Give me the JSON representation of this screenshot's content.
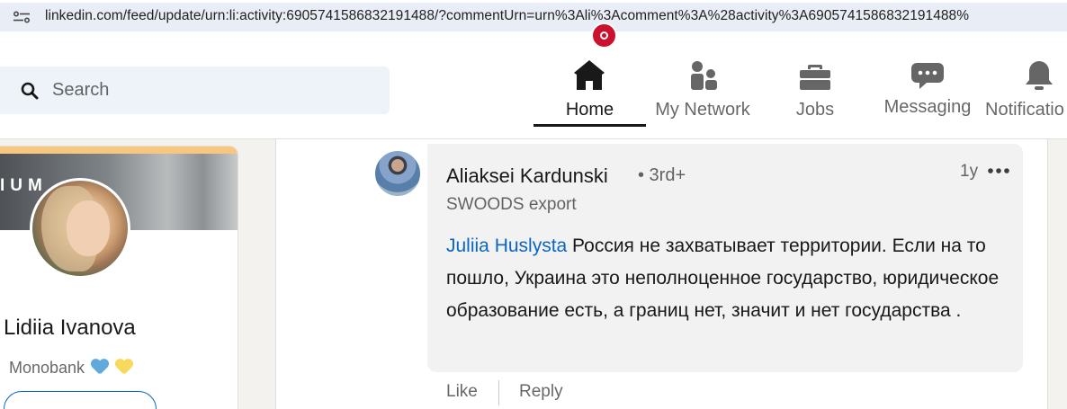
{
  "browser": {
    "url": "linkedin.com/feed/update/urn:li:activity:6905741586832191488/?commentUrn=urn%3Ali%3Acomment%3A%28activity%3A6905741586832191488%"
  },
  "header": {
    "search_placeholder": "Search",
    "nav": [
      {
        "label": "Home",
        "icon": "home-icon",
        "active": true
      },
      {
        "label": "My Network",
        "icon": "network-icon"
      },
      {
        "label": "Jobs",
        "icon": "briefcase-icon"
      },
      {
        "label": "Messaging",
        "icon": "chat-icon"
      },
      {
        "label": "Notificatio",
        "icon": "bell-icon"
      }
    ]
  },
  "profile": {
    "banner_text": "IUM",
    "name": "Lidiia Ivanova",
    "headline": "Monobank"
  },
  "comment": {
    "author": "Aliaksei Kardunski",
    "degree": "• 3rd+",
    "time": "1y",
    "headline": "SWOODS export",
    "mention": "Juliia Huslysta",
    "text": " Россия не захватывает территории. Если на то пошло, Украина это неполноценное государство, юридическое образование есть, а границ нет, значит и нет государства ."
  },
  "actions": {
    "like": "Like",
    "reply": "Reply"
  },
  "colors": {
    "accent_blue": "#0a66c2",
    "notification_red": "#cb112d",
    "premium_gold": "#f8c77e"
  }
}
